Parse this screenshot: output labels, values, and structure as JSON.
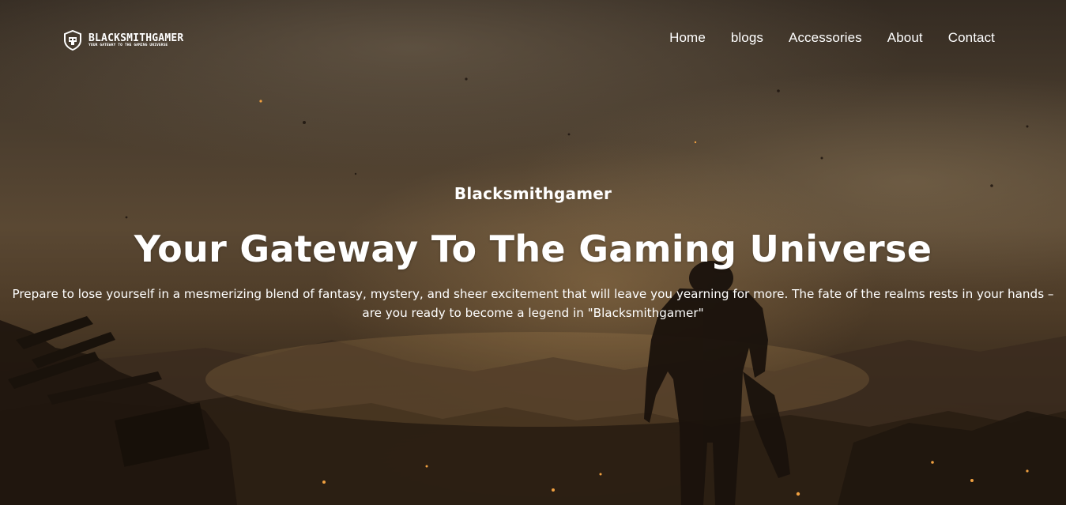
{
  "brand": {
    "name": "BLACKSMITHGAMER",
    "tagline": "YOUR GATEWAY TO THE GAMING UNIVERSE",
    "logo_icon": "helmet-shield-icon"
  },
  "nav": {
    "items": [
      {
        "label": "Home"
      },
      {
        "label": "blogs"
      },
      {
        "label": "Accessories"
      },
      {
        "label": "About"
      },
      {
        "label": "Contact"
      }
    ]
  },
  "hero": {
    "eyebrow": "Blacksmithgamer",
    "headline": "Your Gateway To The Gaming Universe",
    "description": "Prepare to lose yourself in a mesmerizing blend of fantasy, mystery, and sheer excitement that will leave you yearning for more. The fate of the realms rests in your hands – are you ready to become a legend in \"Blacksmithgamer\""
  },
  "theme": {
    "text_color": "#ffffff",
    "background_tone": "#4a3d2e",
    "ember_color": "#f0a040"
  }
}
